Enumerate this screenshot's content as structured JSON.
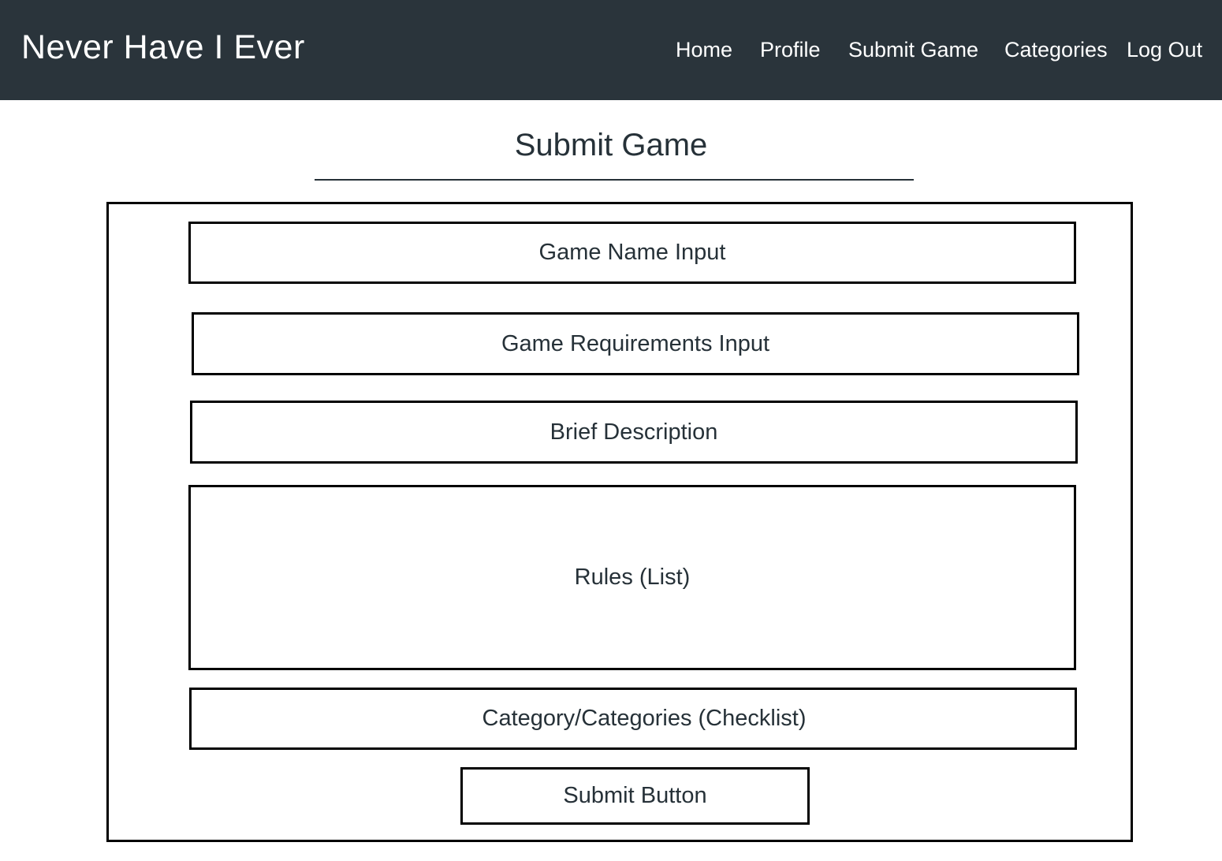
{
  "navbar": {
    "brand": "Never Have I Ever",
    "links": [
      {
        "label": "Home"
      },
      {
        "label": "Profile"
      },
      {
        "label": "Submit Game"
      },
      {
        "label": "Categories"
      },
      {
        "label": "Log Out"
      }
    ]
  },
  "page": {
    "title": "Submit Game"
  },
  "form": {
    "game_name": "Game Name Input",
    "game_requirements": "Game Requirements Input",
    "brief_description": "Brief Description",
    "rules": "Rules (List)",
    "categories": "Category/Categories (Checklist)",
    "submit": "Submit Button"
  },
  "colors": {
    "navbar_bg": "#2a343b",
    "text": "#263138",
    "border": "#000000"
  }
}
